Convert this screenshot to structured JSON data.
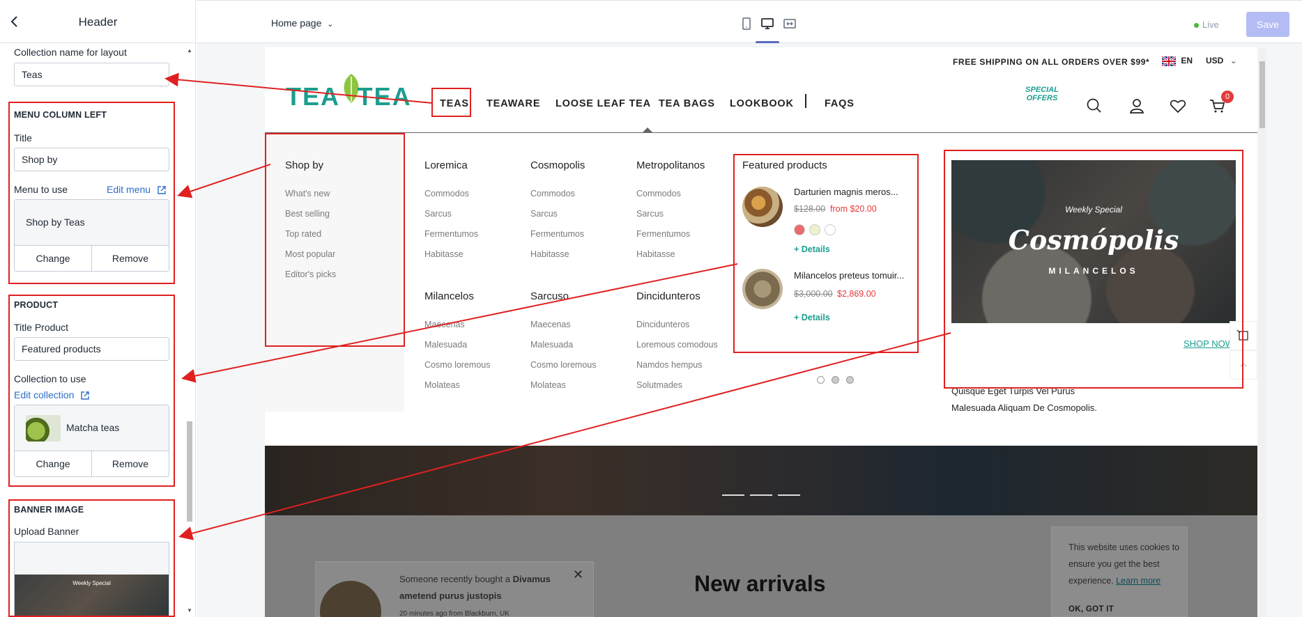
{
  "panel": {
    "title": "Header",
    "collection_layout_label": "Collection name for layout",
    "collection_layout_value": "Teas",
    "menu_left": {
      "section_title": "MENU COLUMN LEFT",
      "title_label": "Title",
      "title_value": "Shop by",
      "menu_label": "Menu to use",
      "edit_menu": "Edit menu",
      "menu_value": "Shop by Teas",
      "change": "Change",
      "remove": "Remove"
    },
    "product": {
      "section_title": "PRODUCT",
      "title_label": "Title Product",
      "title_value": "Featured products",
      "collection_label": "Collection to use",
      "edit_collection": "Edit collection",
      "collection_value": "Matcha teas",
      "change": "Change",
      "remove": "Remove"
    },
    "banner": {
      "section_title": "BANNER IMAGE",
      "upload_label": "Upload Banner",
      "thumb_caption": "Weekly Special"
    }
  },
  "toolbar": {
    "page_select": "Home page",
    "live": "Live",
    "save": "Save"
  },
  "store": {
    "shipping": "FREE SHIPPING ON ALL ORDERS OVER $99*",
    "language": "EN",
    "currency": "USD",
    "logo": "TEA TEA",
    "nav": [
      "TEAS",
      "TEAWARE",
      "LOOSE LEAF TEA",
      "TEA BAGS",
      "LOOKBOOK",
      "FAQS"
    ],
    "special_offers": "SPECIAL OFFERS",
    "cart_count": "0",
    "shop_by": {
      "title": "Shop by",
      "links": [
        "What's new",
        "Best selling",
        "Top rated",
        "Most popular",
        "Editor's picks"
      ]
    },
    "columns": [
      {
        "title": "Loremica",
        "links": [
          "Commodos",
          "Sarcus",
          "Fermentumos",
          "Habitasse"
        ]
      },
      {
        "title": "Cosmopolis",
        "links": [
          "Commodos",
          "Sarcus",
          "Fermentumos",
          "Habitasse"
        ]
      },
      {
        "title": "Metropolitanos",
        "links": [
          "Commodos",
          "Sarcus",
          "Fermentumos",
          "Habitasse"
        ]
      },
      {
        "title": "Milancelos",
        "links": [
          "Maecenas",
          "Malesuada",
          "Cosmo loremous",
          "Molateas"
        ]
      },
      {
        "title": "Sarcuso",
        "links": [
          "Maecenas",
          "Malesuada",
          "Cosmo loremous",
          "Molateas"
        ]
      },
      {
        "title": "Dincidunteros",
        "links": [
          "Dincidunteros",
          "Loremous comodous",
          "Namdos hempus",
          "Solutmades"
        ]
      }
    ],
    "featured": {
      "title": "Featured products",
      "products": [
        {
          "name": "Darturien magnis meros...",
          "old_price": "$128.00",
          "new_price": "from $20.00",
          "details": "Details"
        },
        {
          "name": "Milancelos preteus tomuir...",
          "old_price": "$3,000.00",
          "new_price": "$2,869.00",
          "details": "Details"
        }
      ],
      "swatch_colors": [
        "#e86c6c",
        "#eef0cf",
        "#ffffff"
      ]
    },
    "banner": {
      "kicker": "Weekly Special",
      "title": "Cosmópolis",
      "subtitle": "MILANCELOS",
      "caption1": "Quisque Eget Turpis Vel Purus",
      "caption2": "Malesuada Aliquam De Cosmopolis.",
      "shop_now": "SHOP NOW"
    },
    "popup": {
      "text_prefix": "Someone recently bought a ",
      "text_product": "Divamus ametend purus justopis",
      "time": "20 minutes ago from Blackburn, UK"
    },
    "new_arrivals": "New arrivals",
    "cookie": {
      "text": "This website uses cookies to ensure you get the best experience.",
      "learn_more": "Learn more",
      "ok": "OK, GOT IT"
    }
  },
  "colors": {
    "accent_teal": "#1a9e8f",
    "annotation_red": "#e02020",
    "sale_red": "#e23b3b",
    "shopify_blue": "#2c6ecb"
  }
}
